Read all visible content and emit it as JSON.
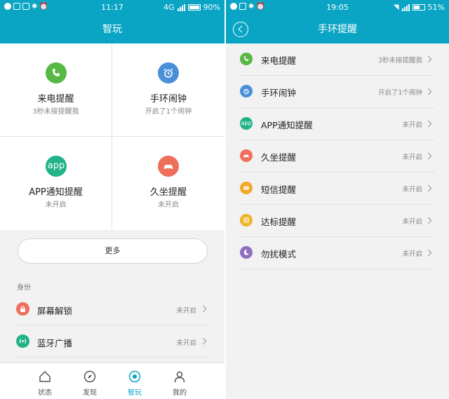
{
  "left": {
    "status": {
      "time": "11:17",
      "network": "4G",
      "battery": "90%",
      "battery_level": 0.9
    },
    "title": "智玩",
    "grid": [
      {
        "icon": "phone-icon",
        "title": "来电提醒",
        "subtitle": "3秒未接提醒我",
        "color": "#58b845"
      },
      {
        "icon": "alarm-clock-icon",
        "title": "手环闹钟",
        "subtitle": "开启了1个闹钟",
        "color": "#4a90d9"
      },
      {
        "icon": "app-icon",
        "icon_text": "app",
        "title": "APP通知提醒",
        "subtitle": "未开启",
        "color": "#21b287"
      },
      {
        "icon": "sofa-icon",
        "title": "久坐提醒",
        "subtitle": "未开启",
        "color": "#ee6f5b"
      }
    ],
    "more_label": "更多",
    "section_label": "身份",
    "list": [
      {
        "icon": "lock-icon",
        "label": "屏幕解锁",
        "status": "未开启",
        "color": "#ee6f5b"
      },
      {
        "icon": "broadcast-icon",
        "label": "蓝牙广播",
        "status": "未开启",
        "color": "#21b287"
      }
    ],
    "tabs": [
      {
        "icon": "home-icon",
        "label": "状态"
      },
      {
        "icon": "compass-icon",
        "label": "发现"
      },
      {
        "icon": "target-icon",
        "label": "智玩",
        "active": true
      },
      {
        "icon": "person-icon",
        "label": "我的"
      }
    ]
  },
  "right": {
    "status": {
      "time": "19:05",
      "battery": "51%",
      "battery_level": 0.51
    },
    "title": "手环提醒",
    "list": [
      {
        "icon": "phone-icon",
        "label": "来电提醒",
        "status": "3秒未接提醒我",
        "color": "#58b845"
      },
      {
        "icon": "alarm-clock-icon",
        "label": "手环闹钟",
        "status": "开启了1个闹钟",
        "color": "#4a90d9"
      },
      {
        "icon": "app-icon",
        "icon_text": "app",
        "label": "APP通知提醒",
        "status": "未开启",
        "color": "#21b287"
      },
      {
        "icon": "sofa-icon",
        "label": "久坐提醒",
        "status": "未开启",
        "color": "#ee6f5b"
      },
      {
        "icon": "message-icon",
        "label": "短信提醒",
        "status": "未开启",
        "color": "#f2a829"
      },
      {
        "icon": "goal-icon",
        "label": "达标提醒",
        "status": "未开启",
        "color": "#f0b428"
      },
      {
        "icon": "moon-icon",
        "label": "勿扰模式",
        "status": "未开启",
        "color": "#8f6fc2"
      }
    ]
  },
  "theme": {
    "accent": "#0aa5c4"
  }
}
